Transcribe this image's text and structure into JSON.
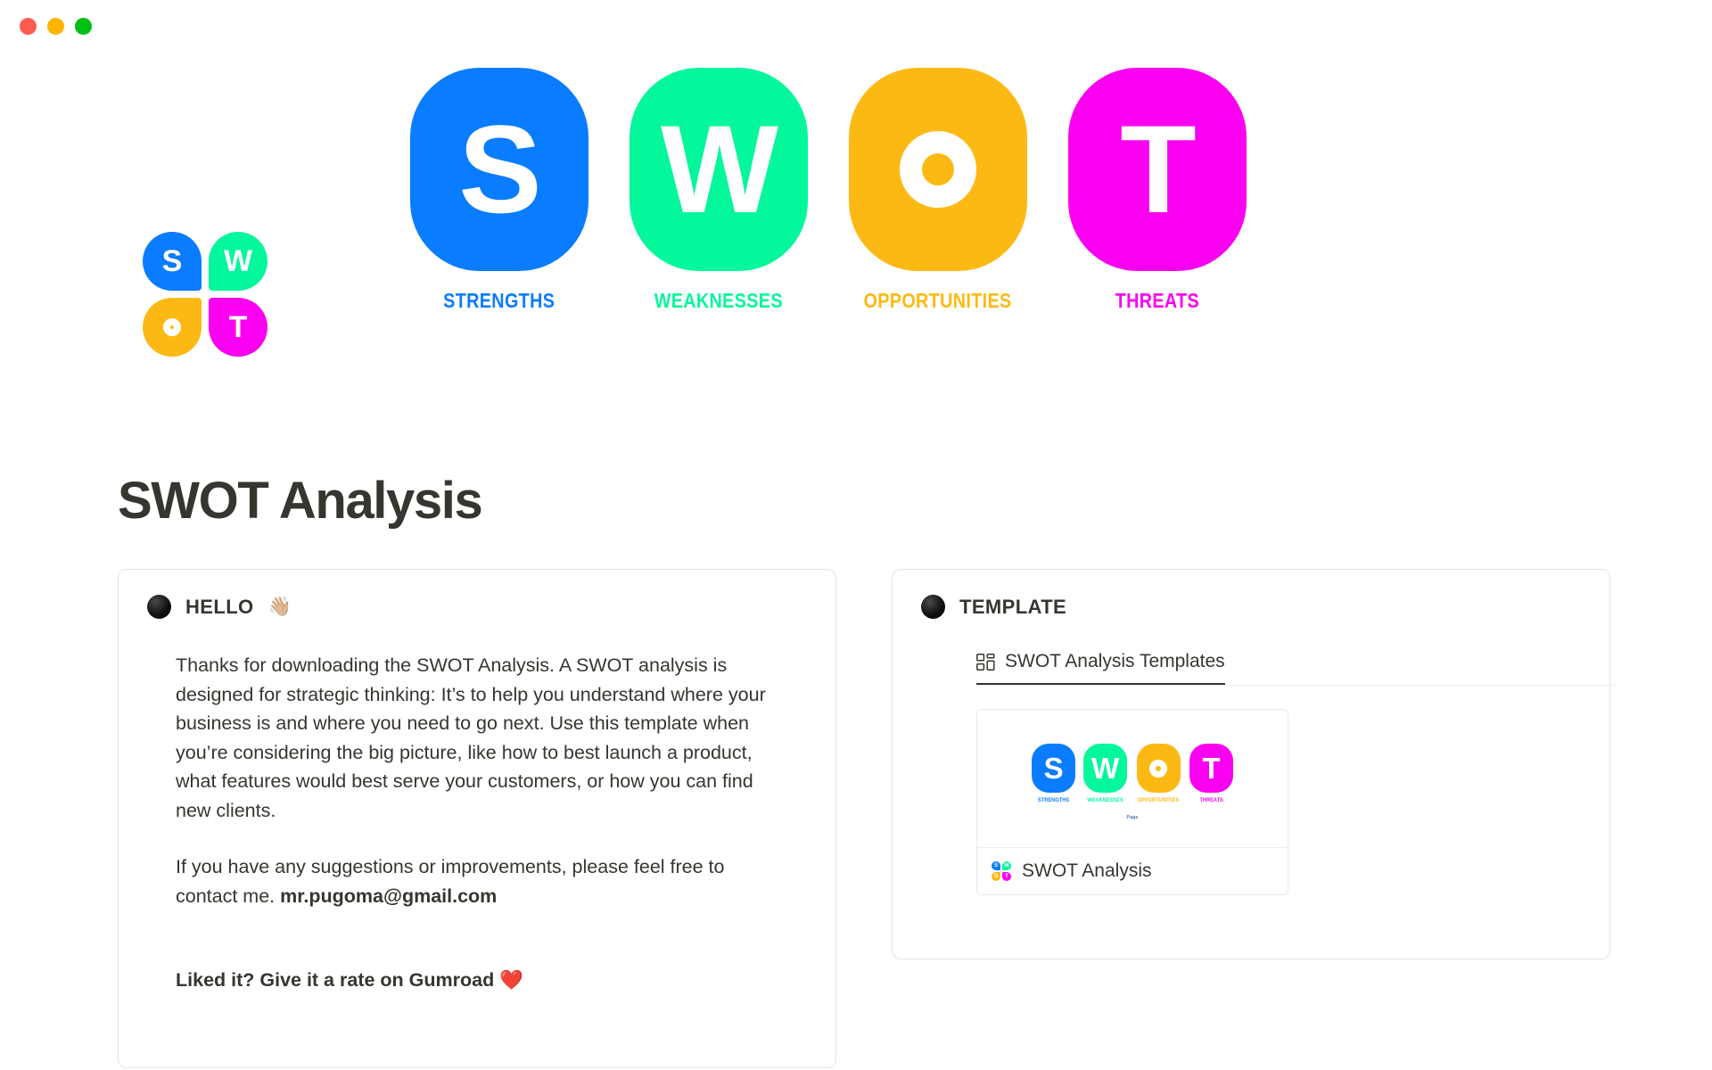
{
  "window": {
    "controls": [
      {
        "name": "close",
        "color": "#FF5A52"
      },
      {
        "name": "minimize",
        "color": "#FFB400"
      },
      {
        "name": "maximize",
        "color": "#00C016"
      }
    ]
  },
  "cover": {
    "tiles": [
      {
        "letter": "S",
        "caption": "STRENGTHS",
        "color": "#0A7CFF"
      },
      {
        "letter": "W",
        "caption": "WEAKNESSES",
        "color": "#05F79B"
      },
      {
        "letter": "O",
        "caption": "OPPORTUNITIES",
        "color": "#FDB913"
      },
      {
        "letter": "T",
        "caption": "THREATS",
        "color": "#FA00F0"
      }
    ]
  },
  "page_icon": {
    "quadrants": [
      {
        "letter": "S",
        "color": "#0A7CFF"
      },
      {
        "letter": "W",
        "color": "#05F79B"
      },
      {
        "letter": "O",
        "color": "#FDB913"
      },
      {
        "letter": "T",
        "color": "#FA00F0"
      }
    ]
  },
  "title": "SWOT Analysis",
  "hello_card": {
    "heading": "HELLO",
    "heading_emoji": "👋🏼",
    "paragraph_1": "Thanks for downloading the SWOT Analysis. A SWOT analysis is designed for strategic thinking: It’s to help you understand where your business is and where you need to go next. Use this template when you’re considering the big picture, like how to best launch a product, what features would best serve your customers, or how you can find new clients.",
    "paragraph_2_prefix": "If you have any suggestions or improvements, please feel free to contact me. ",
    "contact_email": "mr.pugoma@gmail.com",
    "cta": "Liked it? Give it a rate on Gumroad ❤️"
  },
  "template_card": {
    "heading": "TEMPLATE",
    "tab_label": "SWOT Analysis Templates",
    "tab_icon": "gallery-icon",
    "template_item": {
      "name": "SWOT Analysis",
      "thumbnail_page_word": "Page",
      "thumbnail_tiles": [
        {
          "letter": "S",
          "caption": "STRENGTHS",
          "color": "#0A7CFF"
        },
        {
          "letter": "W",
          "caption": "WEAKNESSES",
          "color": "#05F79B"
        },
        {
          "letter": "O",
          "caption": "OPPORTUNITIES",
          "color": "#FDB913"
        },
        {
          "letter": "T",
          "caption": "THREATS",
          "color": "#FA00F0"
        }
      ]
    }
  },
  "colors": {
    "blue": "#0A7CFF",
    "green": "#05F79B",
    "orange": "#FDB913",
    "magenta": "#FA00F0",
    "text": "#37352F",
    "border": "#E4E4E2"
  }
}
